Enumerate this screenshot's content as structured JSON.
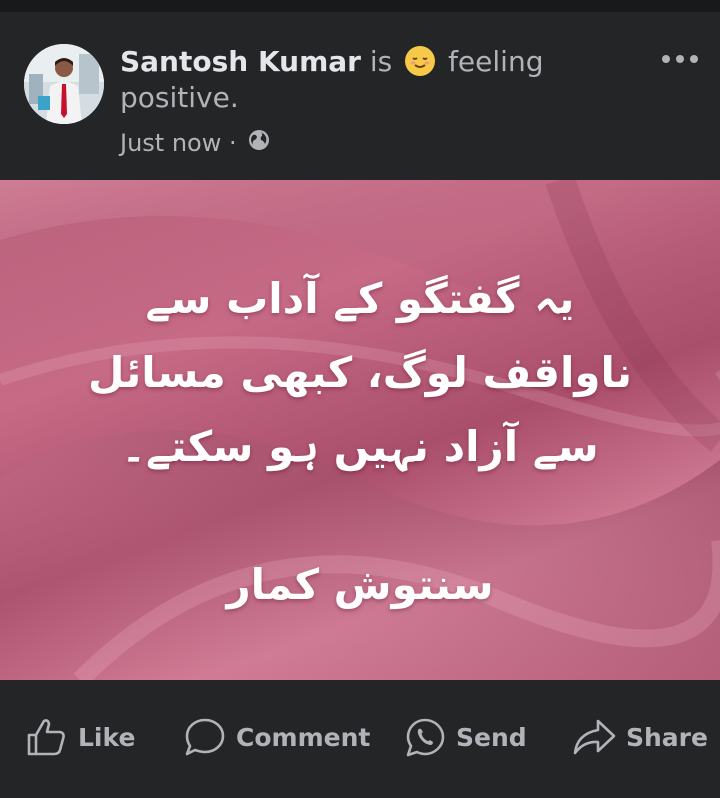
{
  "post": {
    "author": "Santosh Kumar",
    "activity_prefix": "is",
    "emoji": "relieved-face-emoji",
    "activity": "feeling",
    "feeling_line2": "positive.",
    "time": "Just now",
    "separator": "·",
    "privacy_icon": "globe-icon",
    "image_text": {
      "lines": [
        "یہ گفتگو کے آداب سے",
        "ناواقف لوگ، کبھی مسائل",
        "سے آزاد نہیں ہو سکتے۔"
      ],
      "signature": "سنتوش کمار"
    }
  },
  "actions": {
    "like": "Like",
    "comment": "Comment",
    "send": "Send",
    "share": "Share"
  },
  "colors": {
    "background": "#242526",
    "text_primary": "#e4e6eb",
    "text_secondary": "#b0b3b8",
    "image_base": "#c66a86"
  }
}
